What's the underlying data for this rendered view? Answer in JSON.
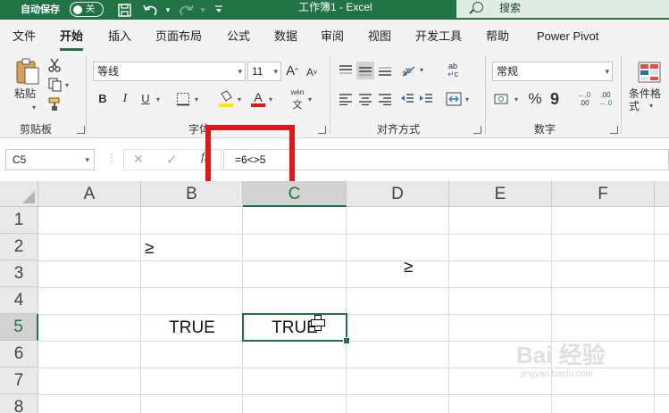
{
  "titlebar": {
    "autosave_label": "自动保存",
    "autosave_state": "关",
    "doc_title": "工作簿1  -  Excel",
    "search_label": "搜索",
    "icons": [
      "save-icon",
      "undo-icon",
      "redo-icon",
      "customize-qat-icon"
    ]
  },
  "tabs": [
    "文件",
    "开始",
    "插入",
    "页面布局",
    "公式",
    "数据",
    "审阅",
    "视图",
    "开发工具",
    "帮助",
    "Power Pivot"
  ],
  "active_tab": "开始",
  "ribbon": {
    "clipboard": {
      "paste_label": "粘贴",
      "group_label": "剪贴板"
    },
    "font": {
      "font_name": "等线",
      "font_size": "11",
      "bold": "B",
      "italic": "I",
      "underline": "U",
      "group_label": "字体",
      "grow": "A",
      "shrink": "A",
      "phonetic_top": "wén",
      "phonetic_bottom": "文"
    },
    "alignment": {
      "group_label": "对齐方式",
      "wrap_glyph": "ab",
      "wrap_glyph2": "c"
    },
    "number": {
      "format": "常规",
      "group_label": "数字",
      "percent": "%",
      "comma": "9",
      "inc_decimal": ".00",
      "dec_decimal": ".00"
    },
    "styles": {
      "conditional_format_label": "条件格式"
    }
  },
  "formula_bar": {
    "name_box": "C5",
    "cancel_glyph": "✕",
    "enter_glyph": "✓",
    "fx_label": "fx",
    "formula": "=6<>5"
  },
  "columns": [
    "A",
    "B",
    "C",
    "D",
    "E",
    "F"
  ],
  "rows": [
    "1",
    "2",
    "3",
    "4",
    "5",
    "6",
    "7",
    "8"
  ],
  "selected_column": "C",
  "selected_row": "5",
  "cells": {
    "B2": "≥",
    "D3": "≥",
    "B5": "TRUE",
    "C5": "TRUE"
  },
  "watermark": {
    "brand": "Bai 经验",
    "url": "jingyan.baidu.com"
  },
  "colors": {
    "accent": "#217346",
    "highlight_box": "#e0161b"
  }
}
